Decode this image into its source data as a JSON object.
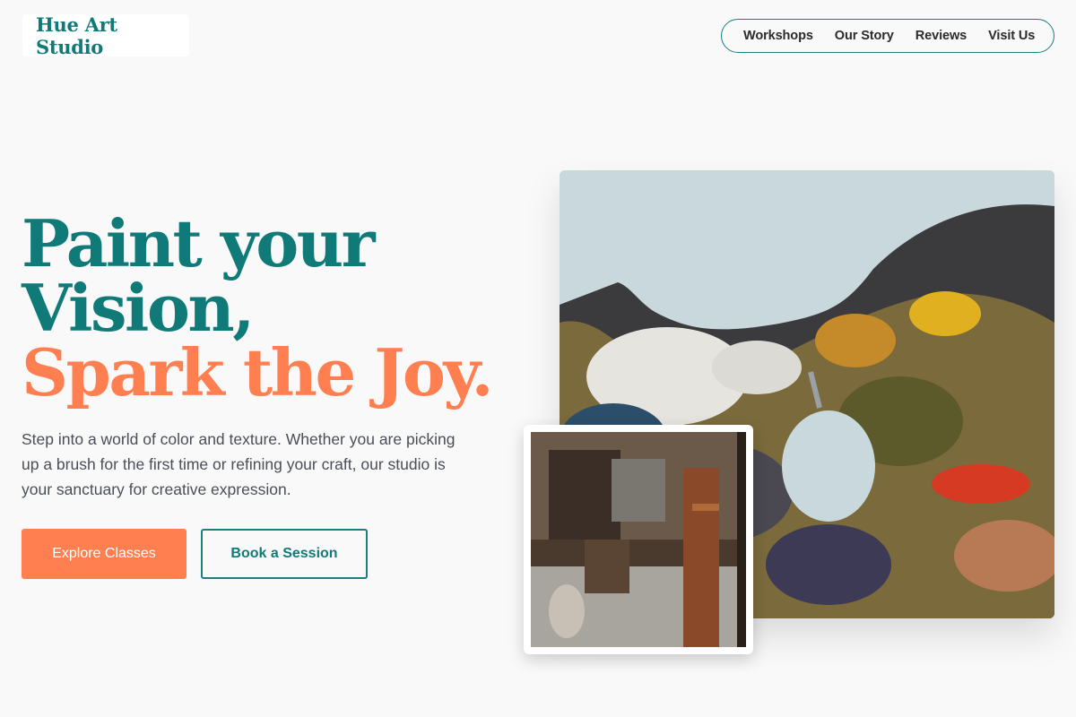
{
  "brand": {
    "name": "Hue Art Studio"
  },
  "nav": {
    "items": [
      "Workshops",
      "Our Story",
      "Reviews",
      "Visit Us"
    ]
  },
  "hero": {
    "headline_line1": "Paint your",
    "headline_line2": "Vision,",
    "headline_line3": "Spark the Joy.",
    "lead": "Step into a world of color and texture. Whether you are picking up a brush for the first time or refining your craft, our studio is your sanctuary for creative expression.",
    "primary_cta": "Explore Classes",
    "secondary_cta": "Book a Session"
  },
  "images": {
    "main": "palette-photo",
    "inset": "studio-interior-photo"
  },
  "colors": {
    "teal": "#0f7a78",
    "coral": "#ff7f50",
    "background": "#f9f9f9"
  }
}
